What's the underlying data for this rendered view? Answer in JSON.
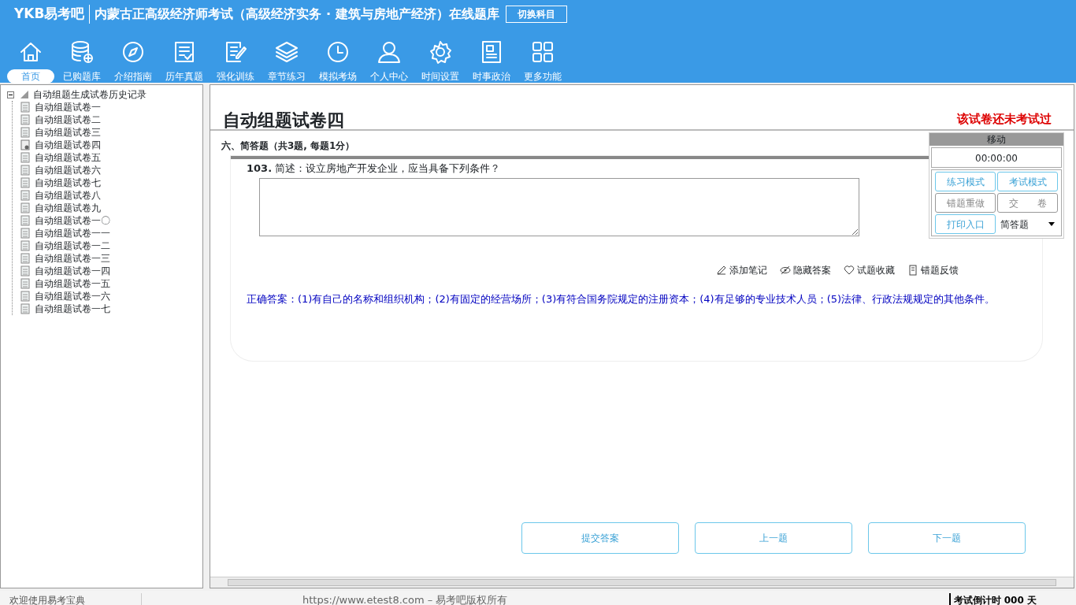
{
  "header": {
    "logo": "YKB易考吧",
    "title": "内蒙古正高级经济师考试（高级经济实务 · 建筑与房地产经济）在线题库",
    "switch_button": "切换科目"
  },
  "nav": [
    {
      "label": "首页",
      "kind": "home",
      "selected": true
    },
    {
      "label": "已购题库",
      "kind": "database",
      "selected": false
    },
    {
      "label": "介绍指南",
      "kind": "compass",
      "selected": false
    },
    {
      "label": "历年真题",
      "kind": "list",
      "selected": false
    },
    {
      "label": "强化训练",
      "kind": "edit",
      "selected": false
    },
    {
      "label": "章节练习",
      "kind": "layers",
      "selected": false
    },
    {
      "label": "模拟考场",
      "kind": "clock",
      "selected": false
    },
    {
      "label": "个人中心",
      "kind": "user",
      "selected": false
    },
    {
      "label": "时间设置",
      "kind": "gear",
      "selected": false
    },
    {
      "label": "时事政治",
      "kind": "news",
      "selected": false
    },
    {
      "label": "更多功能",
      "kind": "grid",
      "selected": false
    }
  ],
  "tree": {
    "label": "自动组题生成试卷历史记录",
    "expanded": true,
    "children": [
      {
        "label": "自动组题试卷一",
        "selected": false
      },
      {
        "label": "自动组题试卷二",
        "selected": false
      },
      {
        "label": "自动组题试卷三",
        "selected": false
      },
      {
        "label": "自动组题试卷四",
        "selected": true
      },
      {
        "label": "自动组题试卷五",
        "selected": false
      },
      {
        "label": "自动组题试卷六",
        "selected": false
      },
      {
        "label": "自动组题试卷七",
        "selected": false
      },
      {
        "label": "自动组题试卷八",
        "selected": false
      },
      {
        "label": "自动组题试卷九",
        "selected": false
      },
      {
        "label": "自动组题试卷一〇",
        "selected": false
      },
      {
        "label": "自动组题试卷一一",
        "selected": false
      },
      {
        "label": "自动组题试卷一二",
        "selected": false
      },
      {
        "label": "自动组题试卷一三",
        "selected": false
      },
      {
        "label": "自动组题试卷一四",
        "selected": false
      },
      {
        "label": "自动组题试卷一五",
        "selected": false
      },
      {
        "label": "自动组题试卷一六",
        "selected": false
      },
      {
        "label": "自动组题试卷一七",
        "selected": false
      }
    ]
  },
  "paper": {
    "title": "自动组题试卷四",
    "status": "该试卷还未考试过",
    "section": "六、简答题（共3题, 每题1分）"
  },
  "question": {
    "number": "103.",
    "text": "简述：设立房地产开发企业，应当具备下列条件？",
    "actions": [
      "添加笔记",
      "隐藏答案",
      "试题收藏",
      "错题反馈"
    ],
    "answer": "正确答案：(1)有自己的名称和组织机构；(2)有固定的经营场所；(3)有符合国务院规定的注册资本；(4)有足够的专业技术人员；(5)法律、行政法规规定的其他条件。"
  },
  "control_panel": {
    "title": "移动",
    "timer": "00:00:00",
    "buttons": [
      {
        "label": "练习模式",
        "disabled": false
      },
      {
        "label": "考试模式",
        "disabled": false
      },
      {
        "label": "错题重做",
        "disabled": true
      },
      {
        "label": "交　　卷",
        "disabled": true
      },
      {
        "label": "打印入口",
        "disabled": false
      }
    ],
    "type_select": "简答题"
  },
  "bottom_buttons": [
    "提交答案",
    "上一题",
    "下一题"
  ],
  "status_bar": {
    "welcome": "欢迎使用易考宝典",
    "copyright": "https://www.etest8.com – 易考吧版权所有",
    "countdown": "考试倒计时 000 天"
  }
}
